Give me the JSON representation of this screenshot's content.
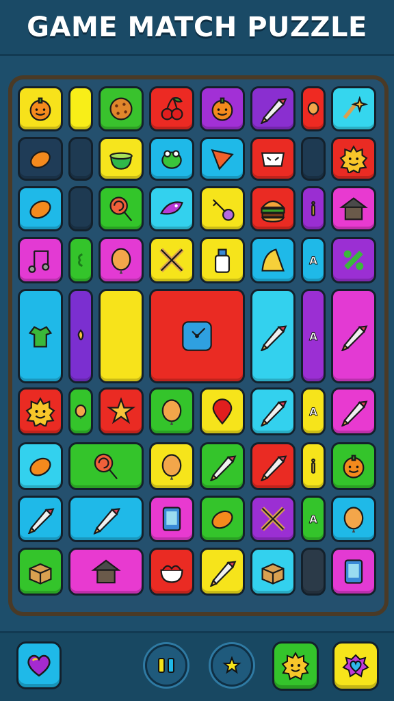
{
  "header": {
    "title": "GAME MATCH PUZZLE"
  },
  "board": {
    "tiles": [
      {
        "icon": "pumpkin-icon",
        "color": "#f7e21b"
      },
      {
        "icon": "empty-slot",
        "color": "#f8ee18"
      },
      {
        "icon": "cookie-icon",
        "color": "#39c22d"
      },
      {
        "icon": "cherries-icon",
        "color": "#ec2a23"
      },
      {
        "icon": "orange-icon",
        "color": "#a230d6"
      },
      {
        "icon": "rocket-icon",
        "color": "#8a2fd0"
      },
      {
        "icon": "stone-icon",
        "color": "#ef2a22"
      },
      {
        "icon": "sparkle-tools-icon",
        "color": "#35d6ee"
      },
      {
        "icon": "mango-icon",
        "color": "#1f3c57"
      },
      {
        "icon": "cauldron-icon",
        "color": "#f6e51d"
      },
      {
        "icon": "frog-icon",
        "color": "#1fb9e8"
      },
      {
        "icon": "triangle-flag-icon",
        "color": "#1fb9e8"
      },
      {
        "icon": "mask-icon",
        "color": "#ea2b23"
      },
      {
        "icon": "sun-face-icon",
        "color": "#ea2b23"
      },
      {
        "icon": "lime-icon",
        "color": "#1fb9e8"
      },
      {
        "icon": "lollipop-icon",
        "color": "#33c52a"
      },
      {
        "icon": "bird-icon",
        "color": "#33d1ee"
      },
      {
        "icon": "key-icon",
        "color": "#f6e41b"
      },
      {
        "icon": "burger-icon",
        "color": "#ea2b23"
      },
      {
        "icon": "info-icon",
        "color": "#9a2ed2"
      },
      {
        "icon": "house-icon",
        "color": "#e83ad0"
      },
      {
        "icon": "music-note-icon",
        "color": "#e33ad3"
      },
      {
        "icon": "bracket-icon",
        "color": "#34c42b"
      },
      {
        "icon": "balloon-icon",
        "color": "#e33ad3"
      },
      {
        "icon": "crossed-tools-icon",
        "color": "#f6e41b"
      },
      {
        "icon": "bottle-icon",
        "color": "#f6e41b"
      },
      {
        "icon": "party-hat-icon",
        "color": "#1fb9e8"
      },
      {
        "icon": "letter-a-icon",
        "color": "#1fb9e8"
      },
      {
        "icon": "percent-icon",
        "color": "#9b2fd3"
      },
      {
        "icon": "shirt-icon",
        "color": "#1fb9e8"
      },
      {
        "icon": "gem-icon",
        "color": "#7b2fd0"
      },
      {
        "icon": "empty-slot",
        "color": "#f7e31b"
      },
      {
        "icon": "clock-icon",
        "color": "#ea2b23"
      },
      {
        "icon": "pencil-icon",
        "color": "#33d1ee"
      },
      {
        "icon": "number-icon",
        "color": "#9b2fd3"
      },
      {
        "icon": "paint-tube-icon",
        "color": "#e33ad3"
      },
      {
        "icon": "starburst-icon",
        "color": "#ea2b23"
      },
      {
        "icon": "drop-icon",
        "color": "#34c42b"
      },
      {
        "icon": "star-icon",
        "color": "#ea2b23"
      },
      {
        "icon": "balloon-icon",
        "color": "#34c42b"
      },
      {
        "icon": "map-pin-icon",
        "color": "#f6e41b"
      },
      {
        "icon": "chisel-icon",
        "color": "#33d1ee"
      },
      {
        "icon": "number-icon",
        "color": "#f6e41b"
      },
      {
        "icon": "eraser-icon",
        "color": "#e83ad0"
      },
      {
        "icon": "bread-icon",
        "color": "#33d1ee"
      },
      {
        "icon": "lollipop-icon",
        "color": "#34c42b"
      },
      {
        "icon": "lemon-icon",
        "color": "#f6e41b"
      },
      {
        "icon": "brush-icon",
        "color": "#34c42b"
      },
      {
        "icon": "pencil-icon",
        "color": "#ea2b23"
      },
      {
        "icon": "stick-icon",
        "color": "#f6e41b"
      },
      {
        "icon": "apple-icon",
        "color": "#34c42b"
      },
      {
        "icon": "brush-icon",
        "color": "#1fb9e8"
      },
      {
        "icon": "wand-icon",
        "color": "#1fb9e8"
      },
      {
        "icon": "phone-icon",
        "color": "#e83ad0"
      },
      {
        "icon": "leaf-icon",
        "color": "#34c42b"
      },
      {
        "icon": "crossed-tools-icon",
        "color": "#9b2fd3"
      },
      {
        "icon": "number-icon",
        "color": "#34c42b"
      },
      {
        "icon": "ball-icon",
        "color": "#1fb9e8"
      },
      {
        "icon": "box-icon",
        "color": "#34c42b"
      },
      {
        "icon": "shop-icon",
        "color": "#e83ad0"
      },
      {
        "icon": "ramen-icon",
        "color": "#ea2b23"
      },
      {
        "icon": "marker-icon",
        "color": "#f6e41b"
      },
      {
        "icon": "crate-icon",
        "color": "#33d1ee"
      },
      {
        "icon": "empty-slot",
        "color": "#2b3a48"
      },
      {
        "icon": "frame-icon",
        "color": "#e33ad3"
      }
    ]
  },
  "toolbar": {
    "heart": {
      "icon": "heart-icon",
      "color": "#1fb9e8"
    },
    "pause": {
      "icon": "pause-icon"
    },
    "star": {
      "icon": "star-icon"
    },
    "sun": {
      "icon": "sun-face-icon",
      "color": "#34c42b"
    },
    "gem": {
      "icon": "gem-heart-icon",
      "color": "#f6e41b"
    }
  }
}
